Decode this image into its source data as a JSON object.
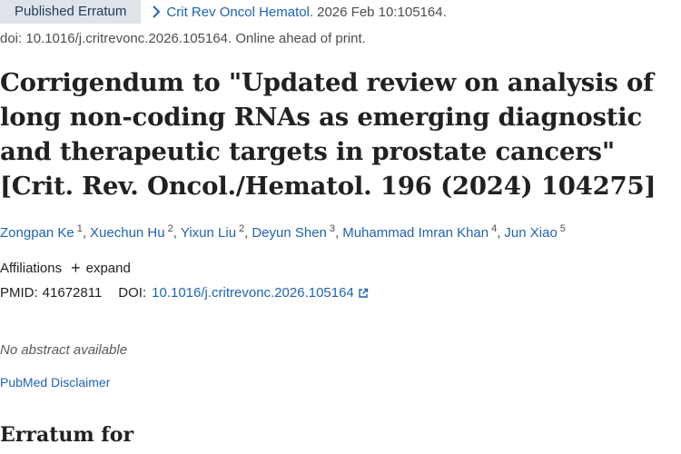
{
  "badge": "Published Erratum",
  "citation": {
    "journal": "Crit Rev Oncol Hematol.",
    "details": "2026 Feb 10:105164."
  },
  "doi_line": "doi: 10.1016/j.critrevonc.2026.105164. Online ahead of print.",
  "title": "Corrigendum to \"Updated review on analysis of long non-coding RNAs as emerging diagnostic and therapeutic targets in prostate cancers\" [Crit. Rev. Oncol./Hematol. 196 (2024) 104275]",
  "authors": [
    {
      "name": "Zongpan Ke",
      "sup": "1"
    },
    {
      "name": "Xuechun Hu",
      "sup": "2"
    },
    {
      "name": "Yixun Liu",
      "sup": "2"
    },
    {
      "name": "Deyun Shen",
      "sup": "3"
    },
    {
      "name": "Muhammad Imran Khan",
      "sup": "4"
    },
    {
      "name": "Jun Xiao",
      "sup": "5"
    }
  ],
  "affiliations": {
    "label": "Affiliations",
    "expand": "expand"
  },
  "ids": {
    "pmid_label": "PMID:",
    "pmid": "41672811",
    "doi_label": "DOI:",
    "doi": "10.1016/j.critrevonc.2026.105164"
  },
  "no_abstract": "No abstract available",
  "disclaimer": "PubMed Disclaimer",
  "erratum_heading": "Erratum for",
  "colors": {
    "link": "#2064b3",
    "badge_bg": "#dfe4ea"
  }
}
